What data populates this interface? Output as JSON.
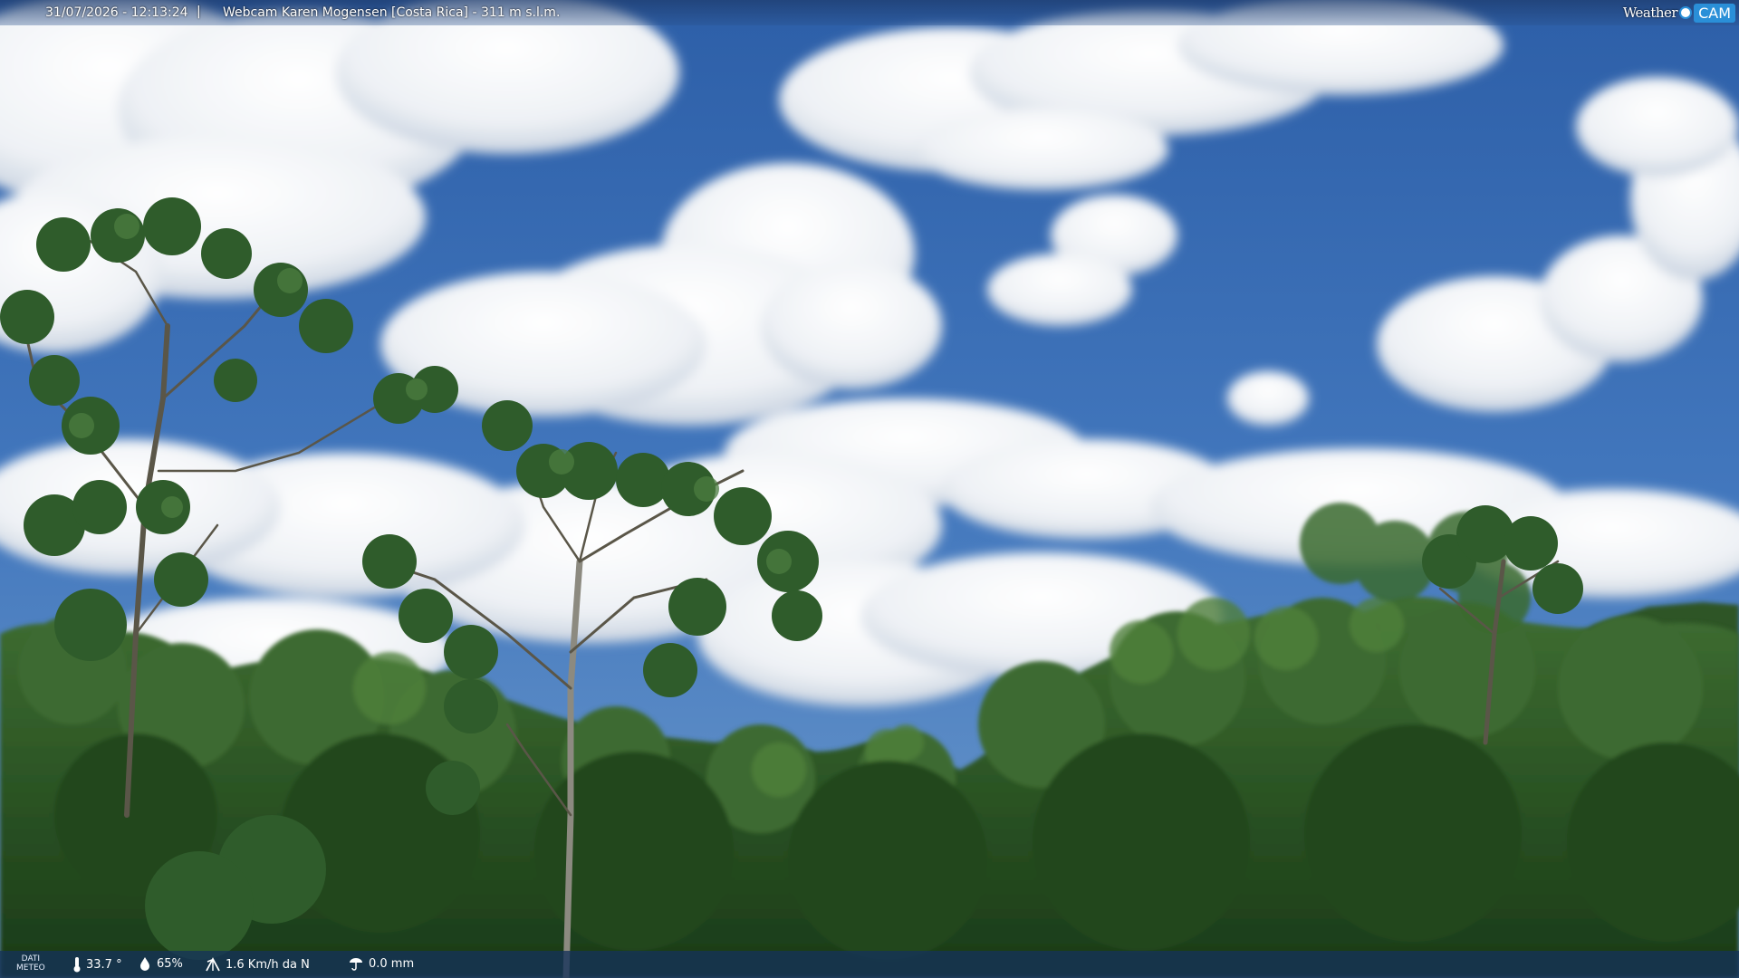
{
  "overlay": {
    "datetime": "31/07/2026 - 12:13:24",
    "separator": "|",
    "camera_title": "Webcam Karen Mogensen [Costa Rica] - 311 m s.l.m."
  },
  "logo": {
    "word1": "Weather",
    "word2": "CAM"
  },
  "weather_data": {
    "label_line1": "DATI",
    "label_line2": "METEO",
    "temperature": "33.7 °",
    "humidity": "65%",
    "wind": "1.6 Km/h da N",
    "rain": "0.0 mm"
  },
  "icons": {
    "temperature": "thermometer-icon",
    "humidity": "humidity-drop-icon",
    "wind": "wind-icon",
    "rain": "rain-gauge-icon"
  },
  "colors": {
    "sky": "#3c6fb0",
    "cloud": "#f2f4f7",
    "forest": "#2f5a26",
    "overlay_bar": "#14325a",
    "logo_accent": "#2a8fd8"
  }
}
